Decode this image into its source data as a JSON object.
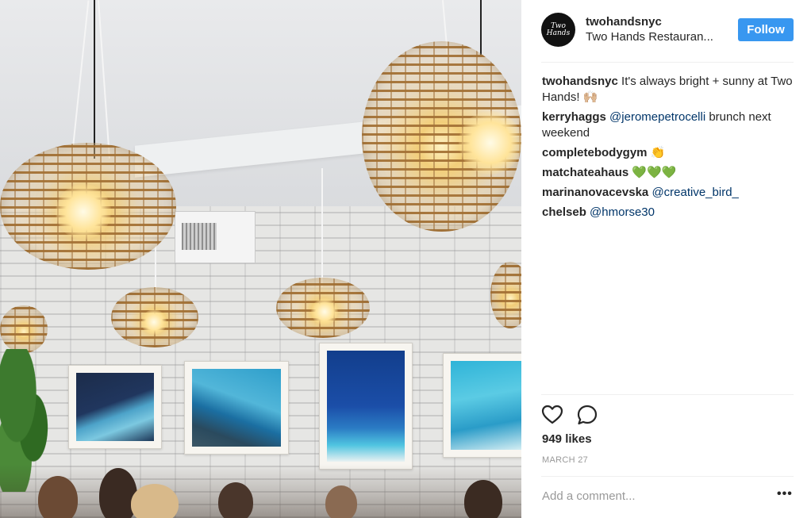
{
  "post": {
    "image_alt": "Restaurant interior with rattan pendant lamps and framed ocean photos",
    "header": {
      "avatar_text": "Two Hands",
      "username": "twohandsnyc",
      "location": "Two Hands Restauran...",
      "follow_label": "Follow"
    },
    "comments": [
      {
        "user": "twohandsnyc",
        "text": "It's always bright + sunny at Two Hands! 🙌🏼"
      },
      {
        "user": "kerryhaggs",
        "mention": "@jeromepetrocelli",
        "text": "brunch next weekend"
      },
      {
        "user": "completebodygym",
        "text": "👏"
      },
      {
        "user": "matchateahaus",
        "text": "💚💚💚"
      },
      {
        "user": "marinanovacevska",
        "mention": "@creative_bird_",
        "text": ""
      },
      {
        "user": "chelseb",
        "mention": "@hmorse30",
        "text": ""
      }
    ],
    "likes": "949 likes",
    "date": "MARCH 27",
    "add_comment_placeholder": "Add a comment...",
    "more_label": "•••"
  },
  "colors": {
    "follow_button": "#3897f0",
    "mention": "#003569",
    "muted": "#999999",
    "text": "#262626"
  },
  "icons": [
    "heart-icon",
    "comment-icon",
    "more-options-icon"
  ]
}
